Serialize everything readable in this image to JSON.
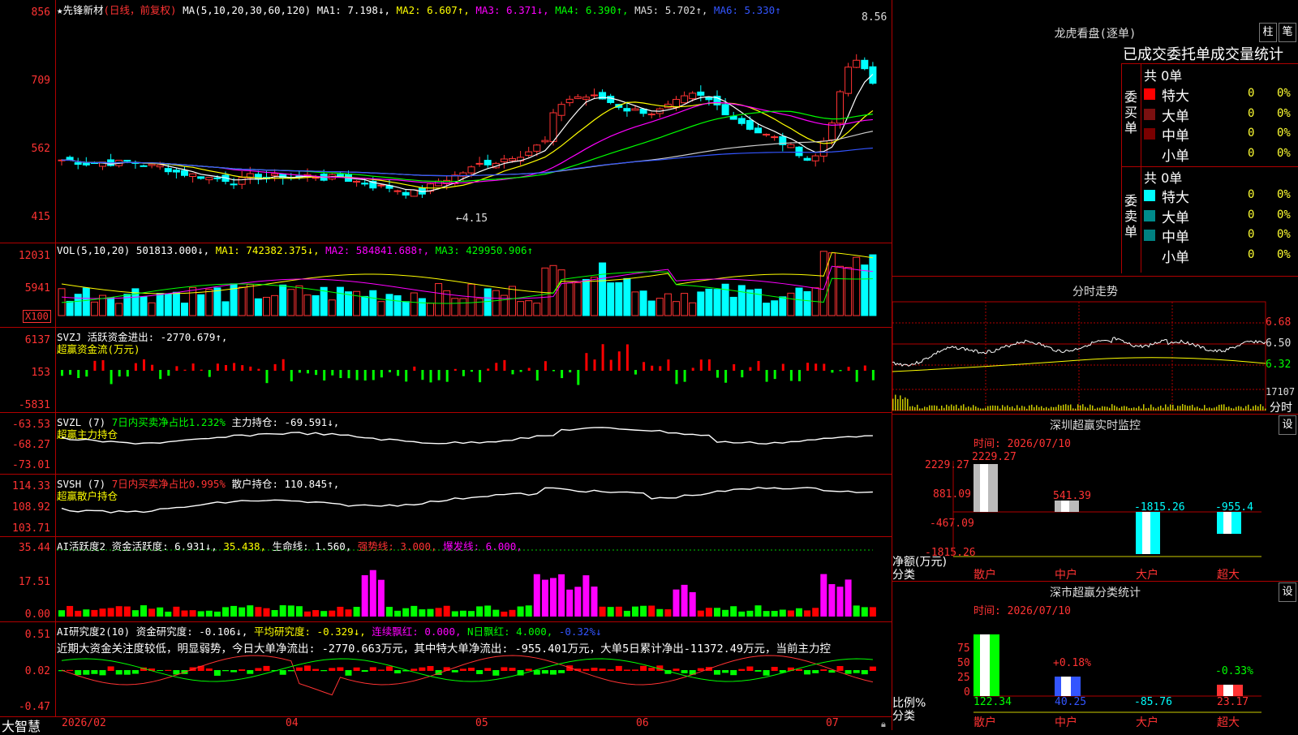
{
  "stock": {
    "name": "★先锋新材",
    "period": "(日线，前复权)"
  },
  "main_pane": {
    "ma_label": "MA(5,10,20,30,60,120)",
    "ma1": "MA1: 7.198↓,",
    "ma2": "MA2: 6.607↑,",
    "ma3": "MA3: 6.371↓,",
    "ma4": "MA4: 6.390↑,",
    "ma5": "MA5: 5.702↑,",
    "ma6": "MA6: 5.330↑",
    "y_ticks": [
      "856",
      "709",
      "562",
      "415"
    ],
    "high_label": "8.56",
    "low_label": "←4.15"
  },
  "vol_pane": {
    "label": "VOL(5,10,20)",
    "v": "501813.000↓,",
    "ma1": "MA1: 742382.375↓,",
    "ma2": "MA2: 584841.688↑,",
    "ma3": "MA3: 429950.906↑",
    "y_ticks": [
      "12031",
      "5941"
    ],
    "unit": "X100"
  },
  "svzj_pane": {
    "label": "SVZJ  活跃资金进出: -2770.679↑,",
    "sub": "超赢资金流(万元)",
    "y_ticks": [
      "6137",
      "153",
      "-5831"
    ]
  },
  "svzl_pane": {
    "label": "SVZL (7)",
    "ratio": "7日内买卖净占比1.232%",
    "hold": "主力持仓: -69.591↓,",
    "sub": "超赢主力持仓",
    "y_ticks": [
      "-63.53",
      "-68.27",
      "-73.01"
    ]
  },
  "svsh_pane": {
    "label": "SVSH (7)",
    "ratio": "7日内买卖净占比0.995%",
    "hold": "散户持仓: 110.845↑,",
    "sub": "超赢散户持仓",
    "y_ticks": [
      "114.33",
      "108.92",
      "103.71"
    ]
  },
  "ai_active_pane": {
    "label": "AI活跃度2 资金活跃度: 6.931↓,",
    "v2": "35.438,",
    "life": "生命线: 1.560,",
    "strong": "强势线: 3.000,",
    "burst": "爆发线: 6.000,",
    "y_ticks": [
      "35.44",
      "17.51",
      "0.00"
    ]
  },
  "ai_research_pane": {
    "label": "AI研究度2(10) 资金研究度: -0.106↓,",
    "avg": "平均研究度: -0.329↓,",
    "cont": "连续飘红: 0.000,",
    "nday": "N日飘红: 4.000,",
    "last": "-0.32%↓",
    "comment": "近期大资金关注度较低，明显弱势，今日大单净流出: -2770.663万元，其中特大单净流出: -955.401万元，大单5日累计净出-11372.49万元，当前主力控",
    "y_ticks": [
      "0.51",
      "0.02",
      "-0.47"
    ]
  },
  "x_axis": {
    "brand": "大智慧",
    "ticks": [
      "2026/02",
      "04",
      "05",
      "06",
      "07"
    ]
  },
  "right_top": {
    "title": "龙虎看盘(逐单)",
    "btn_bar": "柱",
    "btn_pen": "笔",
    "header": "已成交委托单成交量统计",
    "buy_side": "委买单",
    "sell_side": "委卖单",
    "buy_total": "共 0单",
    "sell_total": "共 0单",
    "rows": [
      {
        "label": "特大",
        "val": "0",
        "pct": "0%"
      },
      {
        "label": "大单",
        "val": "0",
        "pct": "0%"
      },
      {
        "label": "中单",
        "val": "0",
        "pct": "0%"
      },
      {
        "label": "小单",
        "val": "0",
        "pct": "0%"
      }
    ],
    "colors": {
      "buy1": "#ff0000",
      "buy2": "#7a1010",
      "buy3": "#7a0000",
      "sell1": "#00ffff",
      "sell2": "#008b8b",
      "sell3": "#008080"
    }
  },
  "intraday": {
    "title": "分时走势",
    "y_ticks": [
      "6.68",
      "6.50",
      "6.32"
    ],
    "vol_tick": "17107",
    "tag": "分时"
  },
  "sz_monitor": {
    "title": "深圳超赢实时监控",
    "btn": "设",
    "date": "时间: 2026/07/10",
    "y_ticks": [
      "2229.27",
      "881.09",
      "-467.09",
      "-1815.26"
    ],
    "bar_labels": [
      "2229.27",
      "541.39",
      "-1815.26",
      "-955.4"
    ],
    "unit": "净额(万元)",
    "cat": "分类",
    "categories": [
      "散户",
      "中户",
      "大户",
      "超大"
    ]
  },
  "sz_class": {
    "title": "深市超赢分类统计",
    "btn": "设",
    "date": "时间: 2026/07/10",
    "y_ticks": [
      "75",
      "50",
      "25",
      "0"
    ],
    "pct_labels": [
      "+0.18%",
      "-0.33%"
    ],
    "values": [
      "122.34",
      "40.25",
      "-85.76",
      "23.17"
    ],
    "unit": "比例%",
    "cat": "分类",
    "categories": [
      "散户",
      "中户",
      "大户",
      "超大"
    ]
  }
}
